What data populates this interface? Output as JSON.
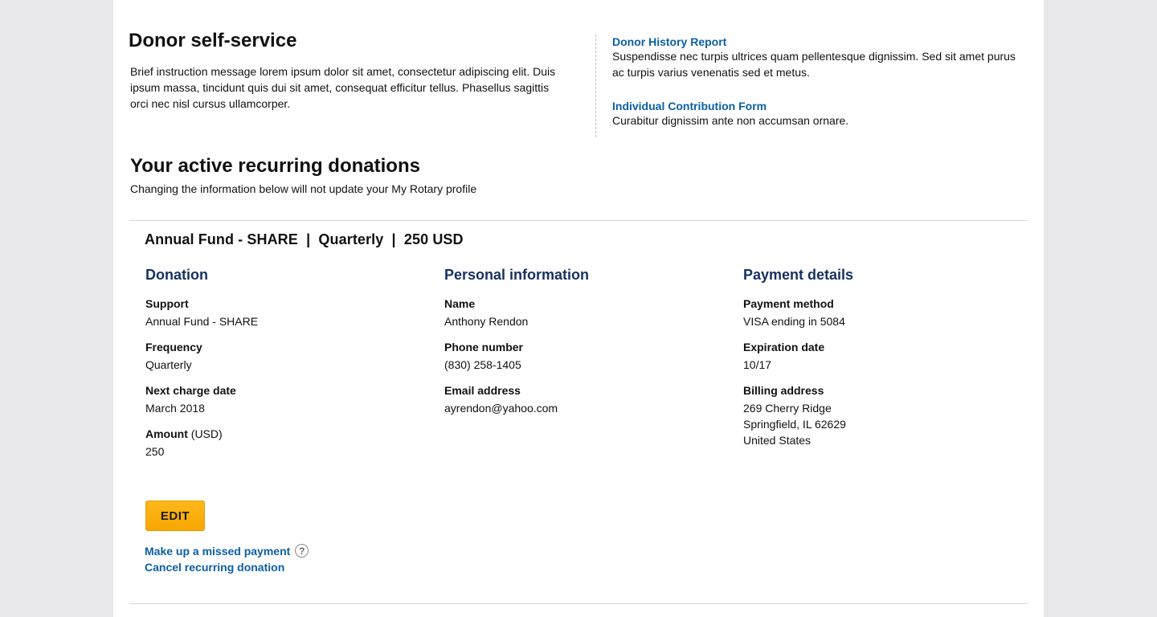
{
  "header": {
    "title": "Donor self-service",
    "intro": "Brief instruction message lorem ipsum dolor sit amet, consectetur adipiscing elit. Duis ipsum massa, tincidunt quis dui sit amet, consequat efficitur tellus. Phasellus sagittis orci nec nisl cursus ullamcorper."
  },
  "resources": [
    {
      "title": "Donor History Report",
      "description": "Suspendisse nec turpis ultrices quam pellentesque dignissim. Sed sit amet purus ac turpis varius venenatis sed et metus."
    },
    {
      "title": "Individual Contribution Form",
      "description": "Curabitur dignissim ante non accumsan ornare."
    }
  ],
  "section": {
    "title": "Your active recurring donations",
    "subtitle": "Changing the information below will not update your My Rotary profile"
  },
  "donation_card": {
    "summary": "Annual Fund - SHARE  |  Quarterly  |  250 USD",
    "donation": {
      "heading": "Donation",
      "support_label": "Support",
      "support_value": "Annual Fund - SHARE",
      "frequency_label": "Frequency",
      "frequency_value": "Quarterly",
      "next_charge_label": "Next charge date",
      "next_charge_value": "March 2018",
      "amount_label": "Amount",
      "amount_unit": " (USD)",
      "amount_value": "250"
    },
    "personal": {
      "heading": "Personal information",
      "name_label": "Name",
      "name_value": "Anthony Rendon",
      "phone_label": "Phone number",
      "phone_value": "(830) 258-1405",
      "email_label": "Email address",
      "email_value": "ayrendon@yahoo.com"
    },
    "payment": {
      "heading": "Payment details",
      "method_label": "Payment method",
      "method_value": "VISA ending in 5084",
      "expiration_label": "Expiration date",
      "expiration_value": "10/17",
      "billing_label": "Billing address",
      "billing_line1": "269 Cherry Ridge",
      "billing_line2": "Springfield, IL 62629",
      "billing_line3": "United States"
    },
    "actions": {
      "edit_label": "EDIT",
      "missed_payment_label": "Make up a missed payment",
      "help_glyph": "?",
      "cancel_label": "Cancel recurring donation"
    }
  },
  "colors": {
    "background": "#e8e8ea",
    "link": "#0b5fa5",
    "heading_navy": "#16305f",
    "button_gold": "#f7a600"
  }
}
